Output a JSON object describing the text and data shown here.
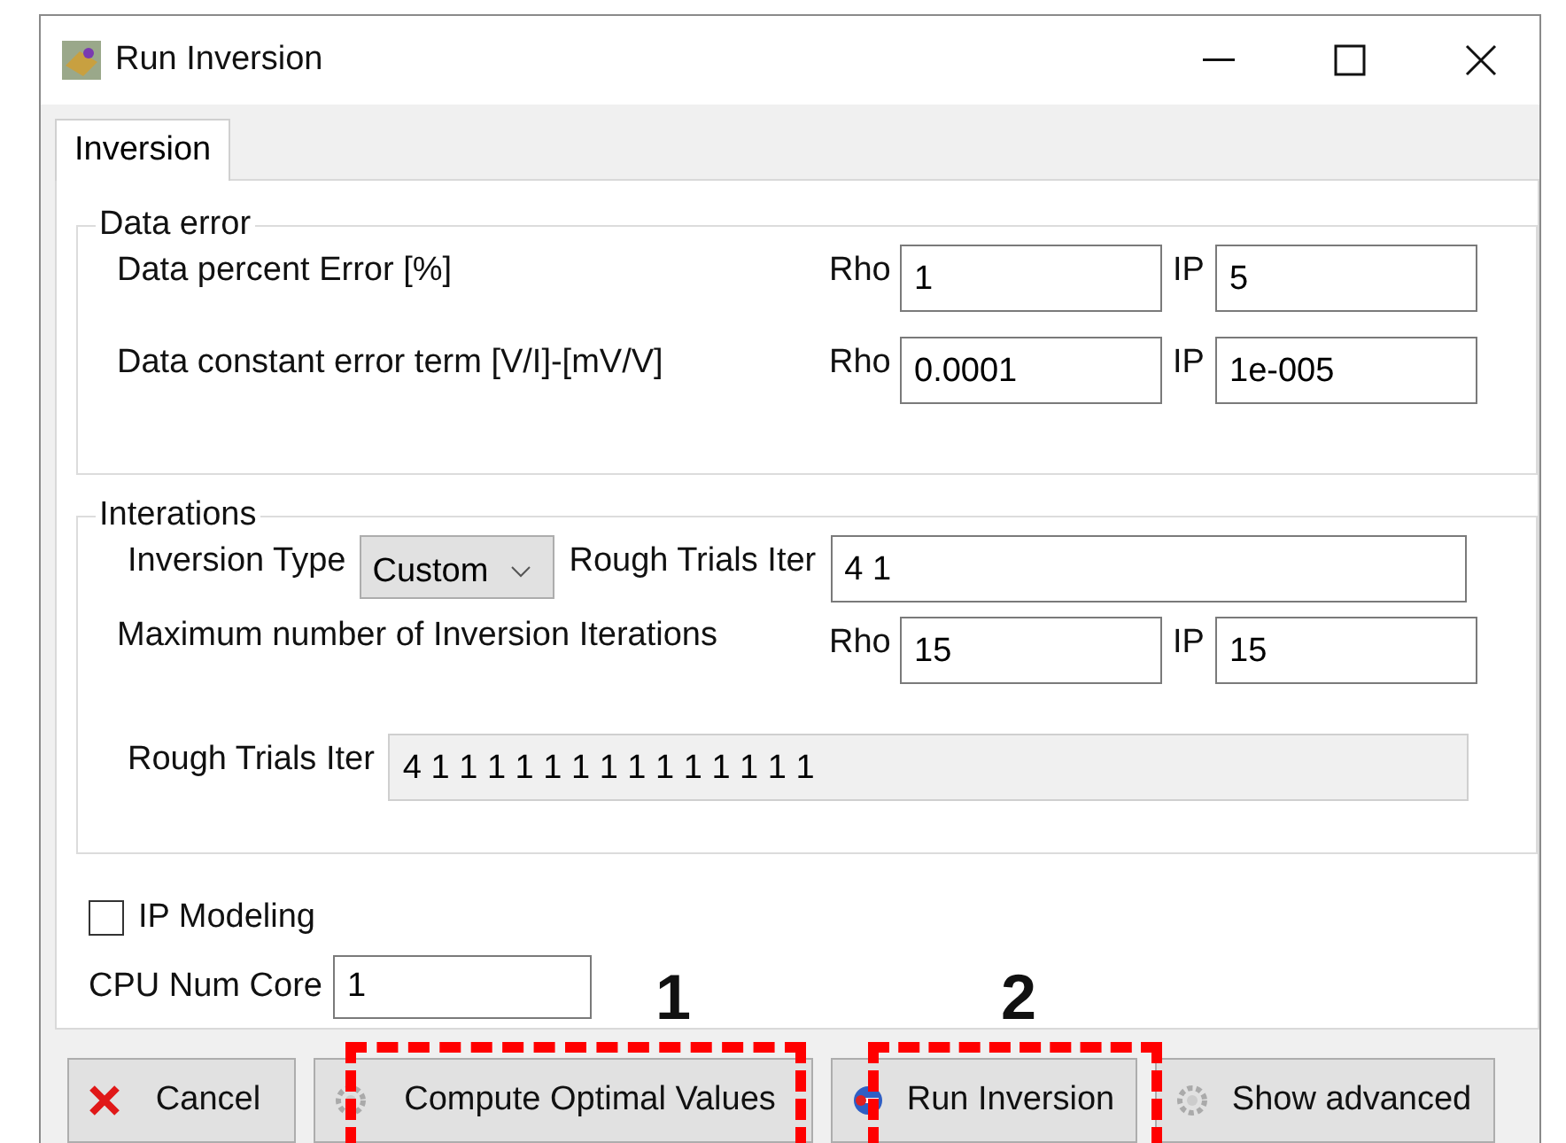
{
  "window": {
    "title": "Run Inversion"
  },
  "tabs": [
    {
      "label": "Inversion",
      "selected": true
    }
  ],
  "data_error": {
    "title": "Data error",
    "rows": [
      {
        "label": "Data percent Error [%]",
        "rho_label": "Rho",
        "rho": "1",
        "ip_label": "IP",
        "ip": "5"
      },
      {
        "label": "Data constant error term [V/I]-[mV/V]",
        "rho_label": "Rho",
        "rho": "0.0001",
        "ip_label": "IP",
        "ip": "1e-005"
      }
    ]
  },
  "iterations": {
    "title": "Interations",
    "inversion_type_label": "Inversion Type",
    "inversion_type": "Custom",
    "rough_trials_label": "Rough Trials Iter",
    "rough_trials": "4 1",
    "max_label": "Maximum number of Inversion Iterations",
    "rho_label": "Rho",
    "rho": "15",
    "ip_label": "IP",
    "ip": "15",
    "rough_trials_all_label": "Rough Trials Iter",
    "rough_trials_all": "4 1 1 1 1 1 1 1 1 1 1 1 1 1 1",
    "rough_trials_all_disabled": true
  },
  "ip_modeling": {
    "label": "IP Modeling",
    "checked": false
  },
  "cpu": {
    "label": "CPU Num Core",
    "value": "1"
  },
  "buttons": [
    {
      "kind": "cancel",
      "label": "Cancel"
    },
    {
      "kind": "gear",
      "label": "Compute Optimal Values"
    },
    {
      "kind": "run",
      "label": "Run Inversion"
    },
    {
      "kind": "gear",
      "label": "Show advanced"
    }
  ],
  "annotations": [
    {
      "label": "1"
    },
    {
      "label": "2"
    }
  ]
}
